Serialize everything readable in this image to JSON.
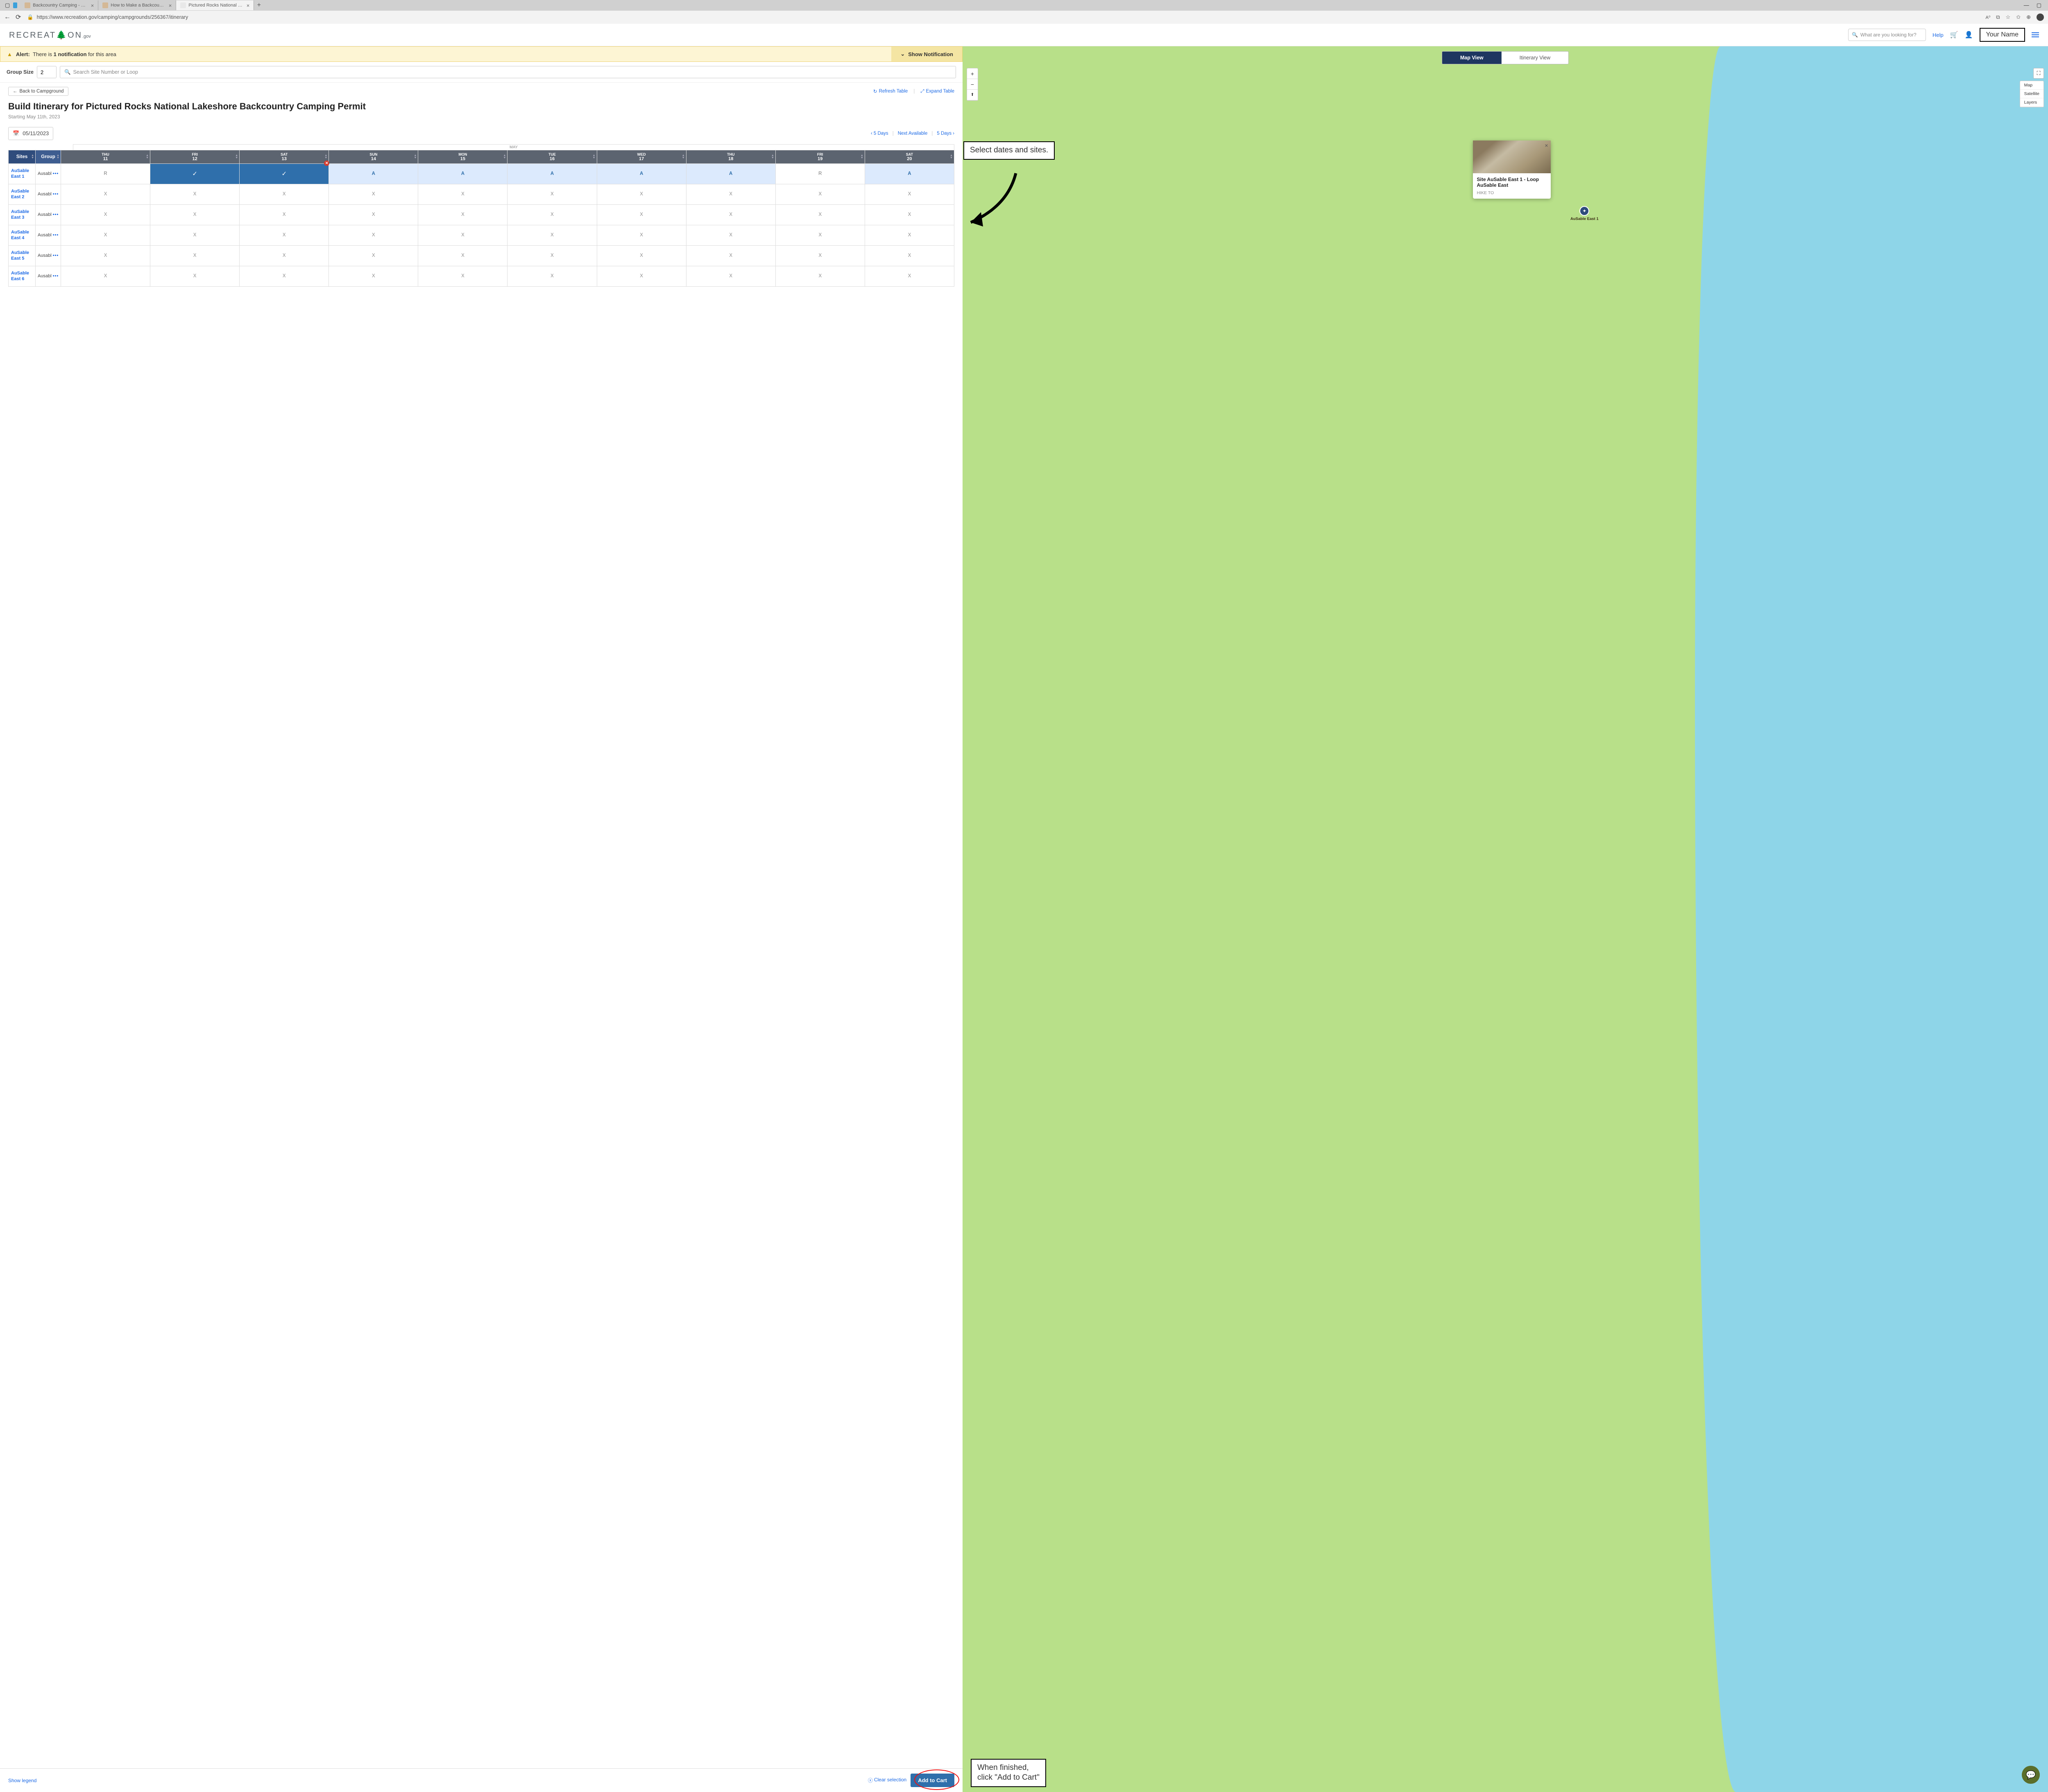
{
  "browser": {
    "tabs": [
      {
        "label": "Backcountry Camping - Pictured"
      },
      {
        "label": "How to Make a Backcountry Ca"
      },
      {
        "label": "Pictured Rocks National Lakesho"
      }
    ],
    "url": "https://www.recreation.gov/camping/campgrounds/256367/itinerary"
  },
  "header": {
    "logo_pre": "RECREAT",
    "logo_post": "ON",
    "logo_suffix": ".gov",
    "search_placeholder": "What are you looking for?",
    "help": "Help",
    "your_name": "Your Name"
  },
  "alert": {
    "prefix": "Alert:",
    "text_before": "There is",
    "count": "1 notification",
    "text_after": "for this area",
    "show": "Show Notification"
  },
  "filters": {
    "group_size_label": "Group Size",
    "group_size_value": "2",
    "site_search_placeholder": "Search Site Number or Loop"
  },
  "nav": {
    "back": "Back to Campground",
    "refresh": "Refresh Table",
    "expand": "Expand Table"
  },
  "heading": {
    "title": "Build Itinerary for Pictured Rocks National Lakeshore Backcountry Camping Permit",
    "sub": "Starting May 11th, 2023"
  },
  "date": {
    "value": "05/11/2023"
  },
  "pager": {
    "prev": "5 Days",
    "mid": "Next Available",
    "next": "5 Days"
  },
  "table": {
    "month": "MAY",
    "col_sites": "Sites",
    "col_group": "Group",
    "days": [
      {
        "dow": "THU",
        "num": "11"
      },
      {
        "dow": "FRI",
        "num": "12"
      },
      {
        "dow": "SAT",
        "num": "13"
      },
      {
        "dow": "SUN",
        "num": "14"
      },
      {
        "dow": "MON",
        "num": "15"
      },
      {
        "dow": "TUE",
        "num": "16"
      },
      {
        "dow": "WED",
        "num": "17"
      },
      {
        "dow": "THU",
        "num": "18"
      },
      {
        "dow": "FRI",
        "num": "19"
      },
      {
        "dow": "SAT",
        "num": "20"
      }
    ],
    "rows": [
      {
        "site": "AuSable East 1",
        "group": "Ausabl",
        "cells": [
          "R",
          "check",
          "check",
          "A",
          "A",
          "A",
          "A",
          "A",
          "R",
          "A"
        ]
      },
      {
        "site": "AuSable East 2",
        "group": "Ausabl",
        "cells": [
          "X",
          "X",
          "X",
          "X",
          "X",
          "X",
          "X",
          "X",
          "X",
          "X"
        ]
      },
      {
        "site": "AuSable East 3",
        "group": "Ausabl",
        "cells": [
          "X",
          "X",
          "X",
          "X",
          "X",
          "X",
          "X",
          "X",
          "X",
          "X"
        ]
      },
      {
        "site": "AuSable East 4",
        "group": "Ausabl",
        "cells": [
          "X",
          "X",
          "X",
          "X",
          "X",
          "X",
          "X",
          "X",
          "X",
          "X"
        ]
      },
      {
        "site": "AuSable East 5",
        "group": "Ausabl",
        "cells": [
          "X",
          "X",
          "X",
          "X",
          "X",
          "X",
          "X",
          "X",
          "X",
          "X"
        ]
      },
      {
        "site": "AuSable East 6",
        "group": "Ausabl",
        "cells": [
          "X",
          "X",
          "X",
          "X",
          "X",
          "X",
          "X",
          "X",
          "X",
          "X"
        ]
      }
    ]
  },
  "bottom": {
    "legend": "Show legend",
    "clear": "Clear selection",
    "add": "Add to Cart"
  },
  "map": {
    "view_map": "Map View",
    "view_itin": "Itinerary View",
    "layers": [
      "Map",
      "Satellite",
      "Layers"
    ],
    "popup_title": "Site AuSable East 1 - Loop AuSable East",
    "popup_sub": "HIKE TO",
    "marker_label": "AuSable East 1"
  },
  "annotations": {
    "a1": "Select dates and sites.",
    "a2_l1": "When finished,",
    "a2_l2": "click \"Add to Cart\""
  }
}
